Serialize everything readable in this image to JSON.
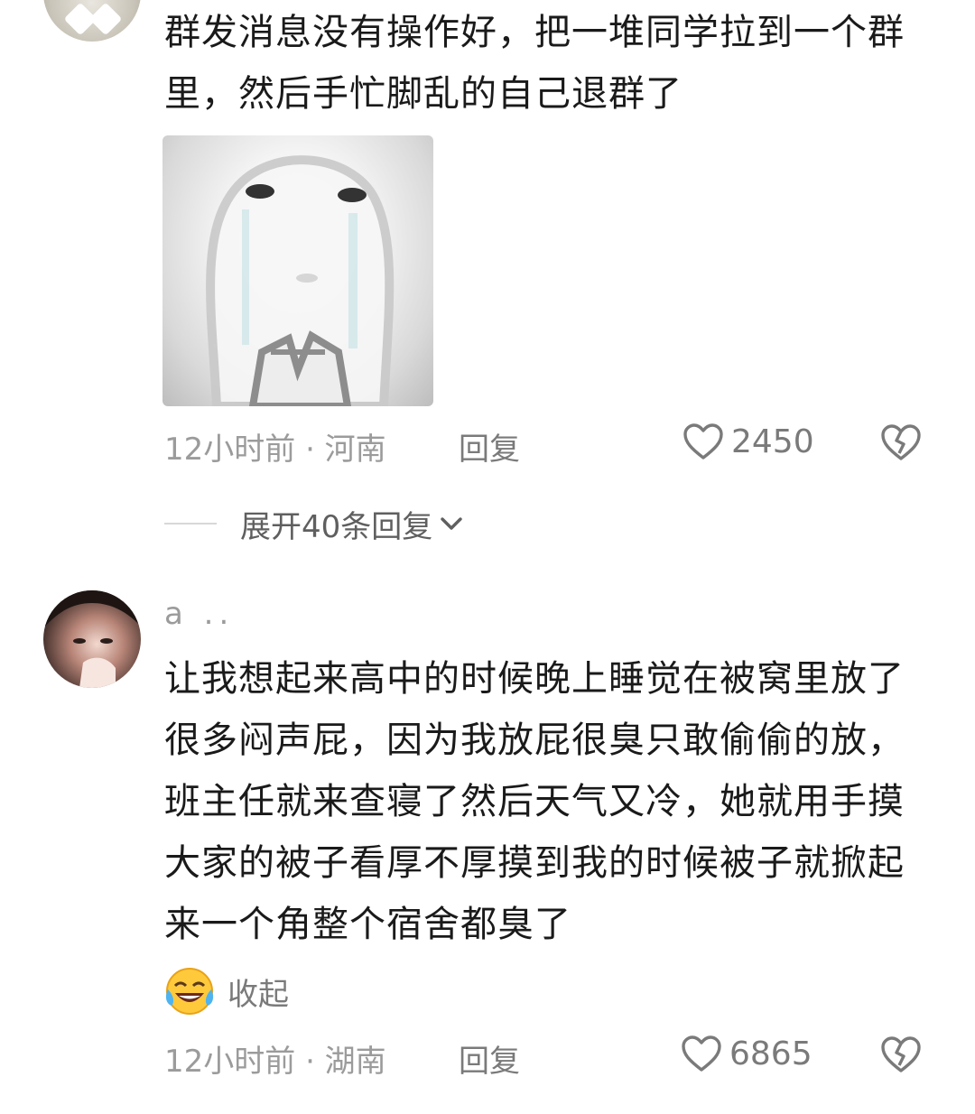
{
  "comments": [
    {
      "text": "群发消息没有操作好，把一堆同学拉到一个群里，然后手忙脚乱的自己退群了",
      "time_location": "12小时前 · 河南",
      "reply_label": "回复",
      "like_count": "2450",
      "expand_label": "展开40条回复"
    },
    {
      "username": "a ..",
      "text": "让我想起来高中的时候晚上睡觉在被窝里放了很多闷声屁，因为我放屁很臭只敢偷偷的放，班主任就来查寝了然后天气又冷，她就用手摸大家的被子看厚不厚摸到我的时候被子就掀起来一个角整个宿舍都臭了",
      "collapse_label": "收起",
      "time_location": "12小时前 · 湖南",
      "reply_label": "回复",
      "like_count": "6865"
    }
  ],
  "icons": {
    "like": "heart-outline-icon",
    "dislike": "broken-heart-icon",
    "expand": "chevron-down-icon",
    "emoji": "laughing-crying-emoji-icon"
  },
  "colors": {
    "text": "#1a1a1a",
    "meta": "#9b9b9b",
    "icon": "#7a7a7a",
    "background": "#ffffff"
  }
}
